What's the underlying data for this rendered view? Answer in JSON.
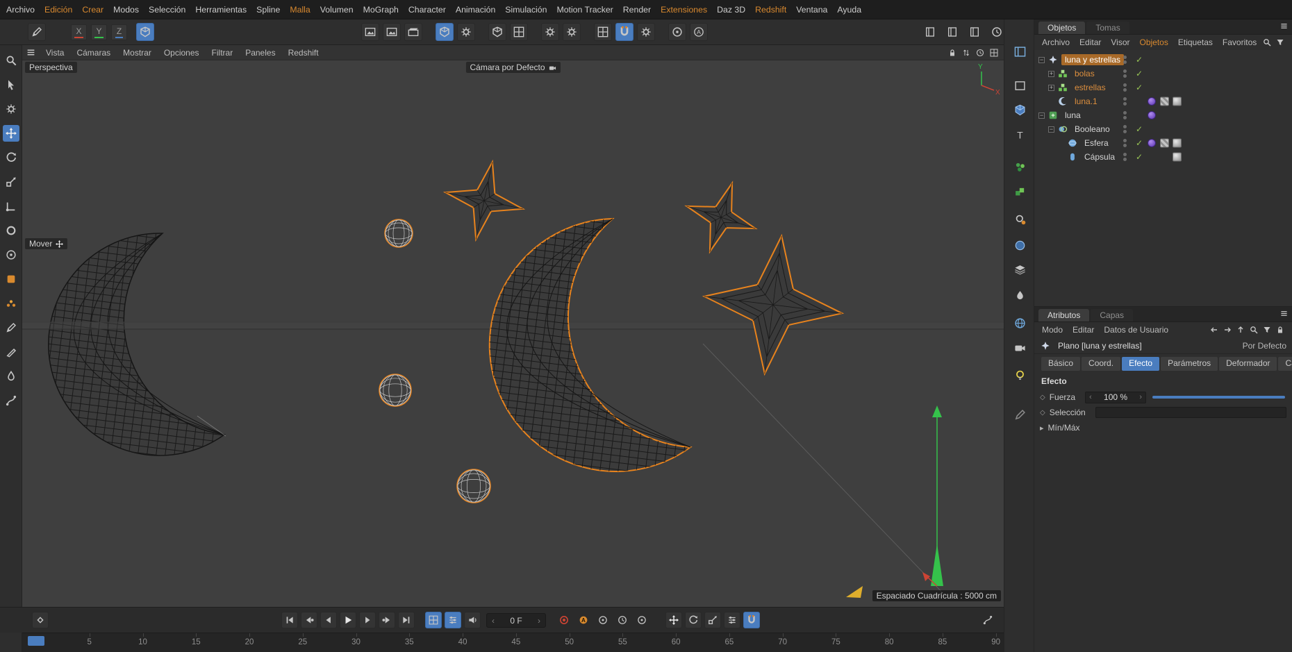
{
  "colors": {
    "accent_blue": "#4a7dbf",
    "selection_orange_bg": "#a96a28",
    "orange_text": "#dd8f3e",
    "menu_highlight_orange": "#d9892f",
    "outline_orange": "#e8831d",
    "axis_green": "#35c24b",
    "axis_red": "#cc4434",
    "material_purple": "#7a4fd0",
    "check_green": "#98c455"
  },
  "menubar": {
    "items": [
      {
        "label": "Archivo",
        "highlighted": false
      },
      {
        "label": "Edición",
        "highlighted": true
      },
      {
        "label": "Crear",
        "highlighted": true
      },
      {
        "label": "Modos",
        "highlighted": false
      },
      {
        "label": "Selección",
        "highlighted": false
      },
      {
        "label": "Herramientas",
        "highlighted": false
      },
      {
        "label": "Spline",
        "highlighted": false
      },
      {
        "label": "Malla",
        "highlighted": true
      },
      {
        "label": "Volumen",
        "highlighted": false
      },
      {
        "label": "MoGraph",
        "highlighted": false
      },
      {
        "label": "Character",
        "highlighted": false
      },
      {
        "label": "Animación",
        "highlighted": false
      },
      {
        "label": "Simulación",
        "highlighted": false
      },
      {
        "label": "Motion Tracker",
        "highlighted": false
      },
      {
        "label": "Render",
        "highlighted": false
      },
      {
        "label": "Extensiones",
        "highlighted": true
      },
      {
        "label": "Daz 3D",
        "highlighted": false
      },
      {
        "label": "Redshift",
        "highlighted": true
      },
      {
        "label": "Ventana",
        "highlighted": false
      },
      {
        "label": "Ayuda",
        "highlighted": false
      }
    ]
  },
  "main_toolbar": {
    "recent_tool": {
      "name": "recent-tool-button",
      "shape": "pen"
    },
    "axis_buttons": [
      {
        "label": "X",
        "color": "#cc4434"
      },
      {
        "label": "Y",
        "color": "#35c24b"
      },
      {
        "label": "Z",
        "color": "#4a7dbf"
      }
    ],
    "workplane": {
      "name": "workplane-mode-button",
      "shape": "cube",
      "active": true
    },
    "center_icons": [
      {
        "name": "render-view-button",
        "shape": "picture"
      },
      {
        "name": "render-region-button",
        "shape": "picture"
      },
      {
        "name": "render-settings-button",
        "shape": "clapper"
      },
      {
        "name": "interactive-render-button",
        "shape": "cube",
        "active": true,
        "gap": true
      },
      {
        "name": "edit-render-settings-button",
        "shape": "gear"
      },
      {
        "name": "model-mode-button",
        "shape": "cube",
        "gap": true
      },
      {
        "name": "texture-mode-button",
        "shape": "grid"
      },
      {
        "name": "modeling-settings-button",
        "shape": "gear",
        "gap": true
      },
      {
        "name": "simulation-settings-button",
        "shape": "gear"
      },
      {
        "name": "snap-settings-button",
        "shape": "grid",
        "gap": true
      },
      {
        "name": "enable-snap-button",
        "shape": "magnet",
        "active": true
      },
      {
        "name": "quantize-button",
        "shape": "gear"
      },
      {
        "name": "safe-frame-button",
        "shape": "circle-dot",
        "gap": true
      },
      {
        "name": "annotation-button",
        "shape": "circle-a"
      }
    ],
    "right_icons": [
      {
        "name": "asset-browser-button",
        "shape": "book"
      },
      {
        "name": "content-browser-button",
        "shape": "book"
      },
      {
        "name": "coordinate-manager-button",
        "shape": "book"
      },
      {
        "name": "scheduler-button",
        "shape": "clock"
      }
    ]
  },
  "left_toolbar": {
    "icons": [
      {
        "name": "zoom-tool-button",
        "shape": "magnifier"
      },
      {
        "name": "live-selection-tool-button",
        "shape": "cursor"
      },
      {
        "name": "selection-filter-button",
        "shape": "gear"
      },
      {
        "name": "move-tool-button",
        "shape": "move",
        "active": true
      },
      {
        "name": "rotate-tool-button",
        "shape": "rotate"
      },
      {
        "name": "scale-tool-button",
        "shape": "scale"
      },
      {
        "name": "axis-modify-button",
        "shape": "axes"
      },
      {
        "name": "coordinate-tool-button",
        "shape": "ring"
      },
      {
        "name": "simulation-tool-button",
        "shape": "circle-dot"
      },
      {
        "name": "colorize-tool-button",
        "shape": "orange-square"
      },
      {
        "name": "particles-tool-button",
        "shape": "orange-dots"
      },
      {
        "name": "pen-tool-button",
        "shape": "pen"
      },
      {
        "name": "knife-tool-button",
        "shape": "knife"
      },
      {
        "name": "brush-tool-button",
        "shape": "brush"
      },
      {
        "name": "spline-tool-button",
        "shape": "spline"
      }
    ]
  },
  "right_toolbar": {
    "icons": [
      {
        "name": "layout-manager-button",
        "shape": "layout"
      },
      {
        "name": "viewport-panel-button",
        "shape": "square"
      },
      {
        "name": "gpu-cube-button",
        "shape": "cube-blue"
      },
      {
        "name": "typography-panel-button",
        "shape": "letter-t"
      },
      {
        "name": "dynamics-panel-button",
        "shape": "balls-green"
      },
      {
        "name": "volume-panel-button",
        "shape": "cubes-green"
      },
      {
        "name": "settings-panel-button",
        "shape": "gear-orange"
      },
      {
        "name": "sculpt-panel-button",
        "shape": "disc-blue"
      },
      {
        "name": "takes-panel-button",
        "shape": "layers"
      },
      {
        "name": "paint-panel-button",
        "shape": "droplet"
      },
      {
        "name": "world-panel-button",
        "shape": "globe-blue"
      },
      {
        "name": "camera-panel-button",
        "shape": "camera"
      },
      {
        "name": "light-panel-button",
        "shape": "bulb"
      },
      {
        "name": "annotation-panel-button",
        "shape": "pencil"
      }
    ]
  },
  "viewport": {
    "menu": [
      "Vista",
      "Cámaras",
      "Mostrar",
      "Opciones",
      "Filtrar",
      "Paneles",
      "Redshift"
    ],
    "menu_icons": [
      {
        "name": "viewport-lock-icon",
        "shape": "lock"
      },
      {
        "name": "viewport-sync-icon",
        "shape": "arrows-ud"
      },
      {
        "name": "viewport-clock-icon",
        "shape": "clock"
      },
      {
        "name": "viewport-layout-icon",
        "shape": "grid"
      }
    ],
    "view_label": "Perspectiva",
    "camera_label": "Cámara por Defecto",
    "tool_hint": "Mover",
    "grid_spacing_label": "Espaciado Cuadrícula : 5000 cm",
    "axis_labels": {
      "x": "X",
      "y": "Y"
    }
  },
  "transport": {
    "frame_value": "0 F",
    "keyframe_marker": {
      "name": "keyframe-diamond-button",
      "shape": "diamond"
    },
    "buttons": [
      {
        "name": "goto-start-button",
        "shape": "tr-start"
      },
      {
        "name": "prev-key-button",
        "shape": "tr-prevkey"
      },
      {
        "name": "prev-frame-button",
        "shape": "tr-prev"
      },
      {
        "name": "play-button",
        "shape": "tr-play"
      },
      {
        "name": "next-frame-button",
        "shape": "tr-next"
      },
      {
        "name": "next-key-button",
        "shape": "tr-nextkey"
      },
      {
        "name": "goto-end-button",
        "shape": "tr-end"
      }
    ],
    "toggles": [
      {
        "name": "marker-mode-toggle",
        "shape": "grid",
        "active": true
      },
      {
        "name": "keyframe-mode-toggle",
        "shape": "sliders",
        "active": true
      },
      {
        "name": "sound-toggle",
        "shape": "speaker"
      }
    ],
    "record_buttons": [
      {
        "name": "record-button",
        "shape": "record-red"
      },
      {
        "name": "autokey-button",
        "shape": "circle-a-orange"
      },
      {
        "name": "keyframe-selection-button",
        "shape": "circle-dot"
      },
      {
        "name": "playback-clock-button",
        "shape": "clock"
      },
      {
        "name": "playback-options-button",
        "shape": "circle-dot"
      }
    ],
    "key_toggles": [
      {
        "name": "record-position-toggle",
        "shape": "move"
      },
      {
        "name": "record-rotation-toggle",
        "shape": "rotate"
      },
      {
        "name": "record-scale-toggle",
        "shape": "scale"
      },
      {
        "name": "record-parameter-toggle",
        "shape": "sliders"
      },
      {
        "name": "snap-magnet-toggle",
        "shape": "magnet",
        "active": true
      }
    ],
    "fcurve_button": {
      "name": "fcurve-button",
      "shape": "spline"
    }
  },
  "timeline": {
    "ticks": [
      "5",
      "10",
      "15",
      "20",
      "25",
      "30",
      "35",
      "40",
      "45",
      "50",
      "55",
      "60",
      "65",
      "70",
      "75",
      "80",
      "85",
      "90"
    ]
  },
  "object_manager": {
    "tabs": [
      {
        "label": "Objetos",
        "active": true
      },
      {
        "label": "Tomas",
        "active": false
      }
    ],
    "menu": [
      "Archivo",
      "Editar",
      "Visor",
      "Objetos",
      "Etiquetas",
      "Favoritos"
    ],
    "menu_highlight": "Objetos",
    "menu_icons": [
      {
        "name": "om-search-icon",
        "shape": "magnifier"
      },
      {
        "name": "om-filter-icon",
        "shape": "funnel"
      }
    ],
    "tree": [
      {
        "label": "luna y estrellas",
        "depth": 0,
        "icon": "effector",
        "selected": true,
        "text_color": "orange",
        "expander": "expanded",
        "check": true,
        "material": false,
        "tags": []
      },
      {
        "label": "bolas",
        "depth": 1,
        "icon": "cloner",
        "selected": false,
        "text_color": "orange",
        "expander": "collapsed",
        "check": true,
        "material": false,
        "tags": []
      },
      {
        "label": "estrellas",
        "depth": 1,
        "icon": "cloner",
        "selected": false,
        "text_color": "orange",
        "expander": "collapsed",
        "check": true,
        "material": false,
        "tags": []
      },
      {
        "label": "luna.1",
        "depth": 1,
        "icon": "spline",
        "selected": false,
        "text_color": "orange",
        "expander": null,
        "check": false,
        "material": true,
        "tags": [
          "texture",
          "phong"
        ]
      },
      {
        "label": "luna",
        "depth": 0,
        "icon": "generator",
        "selected": false,
        "text_color": "white",
        "expander": "expanded",
        "check": false,
        "material": true,
        "tags": []
      },
      {
        "label": "Booleano",
        "depth": 1,
        "icon": "boole",
        "selected": false,
        "text_color": "white",
        "expander": "expanded",
        "check": true,
        "material": false,
        "tags": []
      },
      {
        "label": "Esfera",
        "depth": 2,
        "icon": "sphere",
        "selected": false,
        "text_color": "white",
        "expander": null,
        "check": true,
        "material": true,
        "tags": [
          "texture",
          "phong"
        ]
      },
      {
        "label": "Cápsula",
        "depth": 2,
        "icon": "capsule",
        "selected": false,
        "text_color": "white",
        "expander": null,
        "check": true,
        "material": false,
        "tags": [
          "phong"
        ]
      }
    ]
  },
  "attributes": {
    "tabs": [
      {
        "label": "Atributos",
        "active": true
      },
      {
        "label": "Capas",
        "active": false
      }
    ],
    "menu": [
      "Modo",
      "Editar",
      "Datos de Usuario"
    ],
    "menu_icons": [
      {
        "name": "back-arrow-icon",
        "shape": "arrow-left"
      },
      {
        "name": "forward-arrow-icon",
        "shape": "arrow-right"
      },
      {
        "name": "up-arrow-icon",
        "shape": "arrow-up"
      },
      {
        "name": "am-search-icon",
        "shape": "magnifier"
      },
      {
        "name": "am-filter-icon",
        "shape": "funnel"
      },
      {
        "name": "am-lock-icon",
        "shape": "lock"
      }
    ],
    "object_label": "Plano [luna y estrellas]",
    "preset_label": "Por Defecto",
    "section_tabs": [
      "Básico",
      "Coord.",
      "Efecto",
      "Parámetros",
      "Deformador",
      "Cam"
    ],
    "active_section_tab": "Efecto",
    "section_title": "Efecto",
    "force": {
      "label": "Fuerza",
      "value": "100 %"
    },
    "selection": {
      "label": "Selección"
    },
    "minmax_label": "Mín/Máx"
  }
}
